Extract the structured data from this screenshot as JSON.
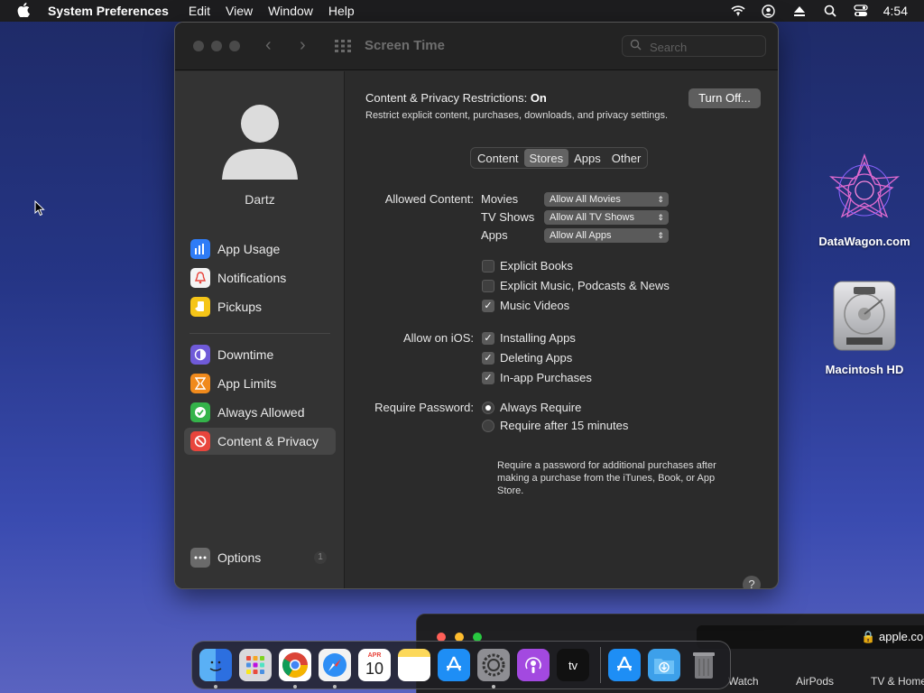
{
  "menubar": {
    "app_name": "System Preferences",
    "items": [
      "Edit",
      "View",
      "Window",
      "Help"
    ],
    "clock": "4:54",
    "status_icons": [
      "wifi-icon",
      "user-icon",
      "eject-icon",
      "search-icon",
      "control-center-icon"
    ]
  },
  "desktop": {
    "icons": [
      {
        "label": "DataWagon.com",
        "icon": "datawagon-logo-icon"
      },
      {
        "label": "Macintosh HD",
        "icon": "hard-drive-icon"
      }
    ]
  },
  "background_window": {
    "address": "apple.com",
    "tabs": [
      "Watch",
      "AirPods",
      "TV & Home"
    ]
  },
  "window": {
    "title": "Screen Time",
    "search_placeholder": "Search",
    "user_name": "Dartz",
    "sidebar": {
      "group1": [
        {
          "label": "App Usage",
          "color": "#2f7cf6"
        },
        {
          "label": "Notifications",
          "color": "#e8453c"
        },
        {
          "label": "Pickups",
          "color": "#f5c518"
        }
      ],
      "group2": [
        {
          "label": "Downtime",
          "color": "#6f5ad8"
        },
        {
          "label": "App Limits",
          "color": "#f08a1c"
        },
        {
          "label": "Always Allowed",
          "color": "#34b34a"
        },
        {
          "label": "Content & Privacy",
          "color": "#e8453c"
        }
      ],
      "options_label": "Options",
      "options_badge": "1"
    },
    "content": {
      "restrictions_label": "Content & Privacy Restrictions:",
      "restrictions_state": "On",
      "subtitle": "Restrict explicit content, purchases, downloads, and privacy settings.",
      "turn_off_button": "Turn Off...",
      "tabs": [
        "Content",
        "Stores",
        "Apps",
        "Other"
      ],
      "selected_tab": "Stores",
      "allowed_content": {
        "label": "Allowed Content:",
        "rows": [
          {
            "name": "Movies",
            "value": "Allow All Movies"
          },
          {
            "name": "TV Shows",
            "value": "Allow All TV Shows"
          },
          {
            "name": "Apps",
            "value": "Allow All Apps"
          }
        ]
      },
      "content_checks": [
        {
          "label": "Explicit Books",
          "checked": false
        },
        {
          "label": "Explicit Music, Podcasts & News",
          "checked": false
        },
        {
          "label": "Music Videos",
          "checked": true
        }
      ],
      "ios": {
        "label": "Allow on iOS:",
        "checks": [
          {
            "label": "Installing Apps",
            "checked": true
          },
          {
            "label": "Deleting Apps",
            "checked": true
          },
          {
            "label": "In-app Purchases",
            "checked": true
          }
        ]
      },
      "password": {
        "label": "Require Password:",
        "options": [
          {
            "label": "Always Require",
            "selected": true
          },
          {
            "label": "Require after 15 minutes",
            "selected": false
          }
        ],
        "note": "Require a password for additional purchases after making a purchase from the iTunes, Book, or App Store."
      },
      "help_label": "?"
    }
  },
  "dock": {
    "calendar_month": "APR",
    "calendar_day": "10",
    "tv_label": "tv",
    "apps": [
      "finder-icon",
      "launchpad-icon",
      "chrome-icon",
      "safari-icon",
      "calendar-icon",
      "notes-icon",
      "app-store-icon",
      "system-preferences-icon",
      "podcasts-icon",
      "apple-tv-icon",
      "app-store-folder-icon",
      "downloads-icon",
      "trash-icon"
    ]
  }
}
